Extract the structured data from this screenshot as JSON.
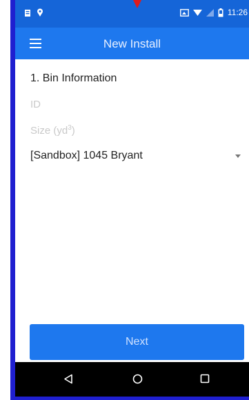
{
  "status_bar": {
    "time": "11:26",
    "left_icons": [
      "notification-icon",
      "location-icon"
    ],
    "right_icons": [
      "cast-icon",
      "wifi-icon",
      "signal-icon",
      "battery-icon"
    ]
  },
  "app_bar": {
    "title": "New Install",
    "menu_icon": "hamburger-menu-icon"
  },
  "form": {
    "section_title": "1. Bin Information",
    "id_placeholder": "ID",
    "size_placeholder_base": "Size (yd",
    "size_placeholder_sup": "3",
    "size_placeholder_close": ")",
    "location_select_value": "[Sandbox] 1045 Bryant"
  },
  "actions": {
    "next_label": "Next"
  },
  "nav_bar": {
    "icons": [
      "back-icon",
      "home-icon",
      "recents-icon"
    ]
  },
  "colors": {
    "status_bar": "#1565d8",
    "app_bar": "#1e78ee",
    "button": "#1e78ee",
    "frame": "#1f1fd0",
    "pointer": "#e01b1b"
  }
}
